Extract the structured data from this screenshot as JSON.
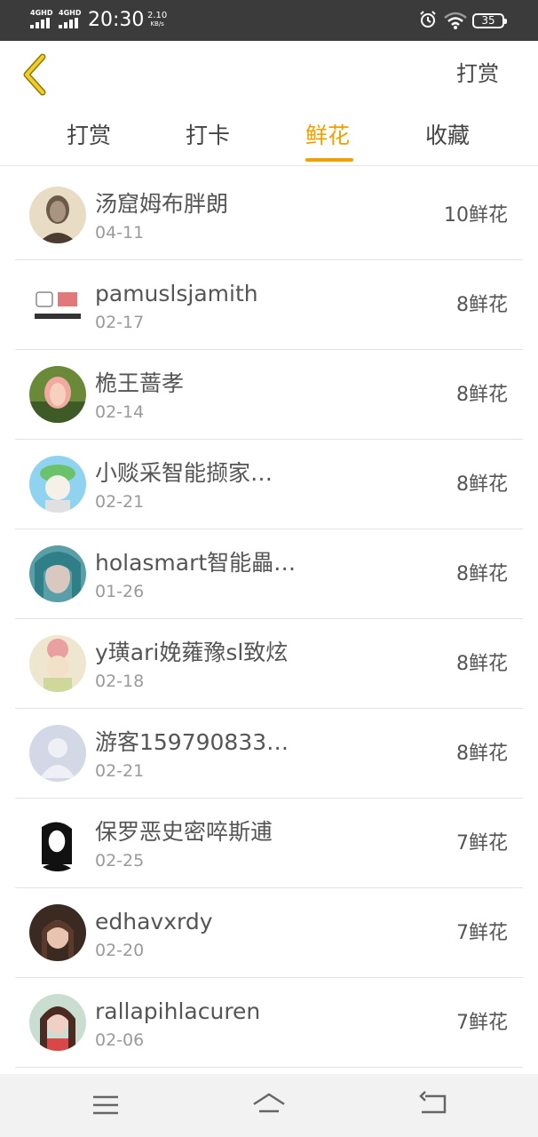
{
  "status_bar": {
    "network1": "4GHD",
    "network2": "4GHD",
    "time": "20:30",
    "speed_value": "2.10",
    "speed_unit": "KB/s",
    "battery": "35"
  },
  "header": {
    "back_icon": "chevron-left-icon",
    "action_label": "打赏"
  },
  "tabs": [
    {
      "label": "打赏",
      "active": false
    },
    {
      "label": "打卡",
      "active": false
    },
    {
      "label": "鲜花",
      "active": true
    },
    {
      "label": "收藏",
      "active": false
    }
  ],
  "accent_color": "#f0a000",
  "list": [
    {
      "name": "汤窟姆布胖朗",
      "date": "04-11",
      "amount": "10鲜花"
    },
    {
      "name": "pamuslsjamith",
      "date": "02-17",
      "amount": "8鲜花"
    },
    {
      "name": "桅王蔷孝",
      "date": "02-14",
      "amount": "8鲜花"
    },
    {
      "name": "小赕采智能撷家…",
      "date": "02-21",
      "amount": "8鲜花"
    },
    {
      "name": "holasmart智能畾…",
      "date": "01-26",
      "amount": "8鲜花"
    },
    {
      "name": "y璜ari娩蕹豫sl致炫",
      "date": "02-18",
      "amount": "8鲜花"
    },
    {
      "name": "游客159790833…",
      "date": "02-21",
      "amount": "8鲜花"
    },
    {
      "name": "保罗恶史密啐斯逋",
      "date": "02-25",
      "amount": "7鲜花"
    },
    {
      "name": "edhavxrdy",
      "date": "02-20",
      "amount": "7鲜花"
    },
    {
      "name": "rallapihlacuren",
      "date": "02-06",
      "amount": "7鲜花"
    }
  ],
  "nav": {
    "menu_icon": "menu-icon",
    "home_icon": "home-icon",
    "back_icon": "return-icon"
  }
}
